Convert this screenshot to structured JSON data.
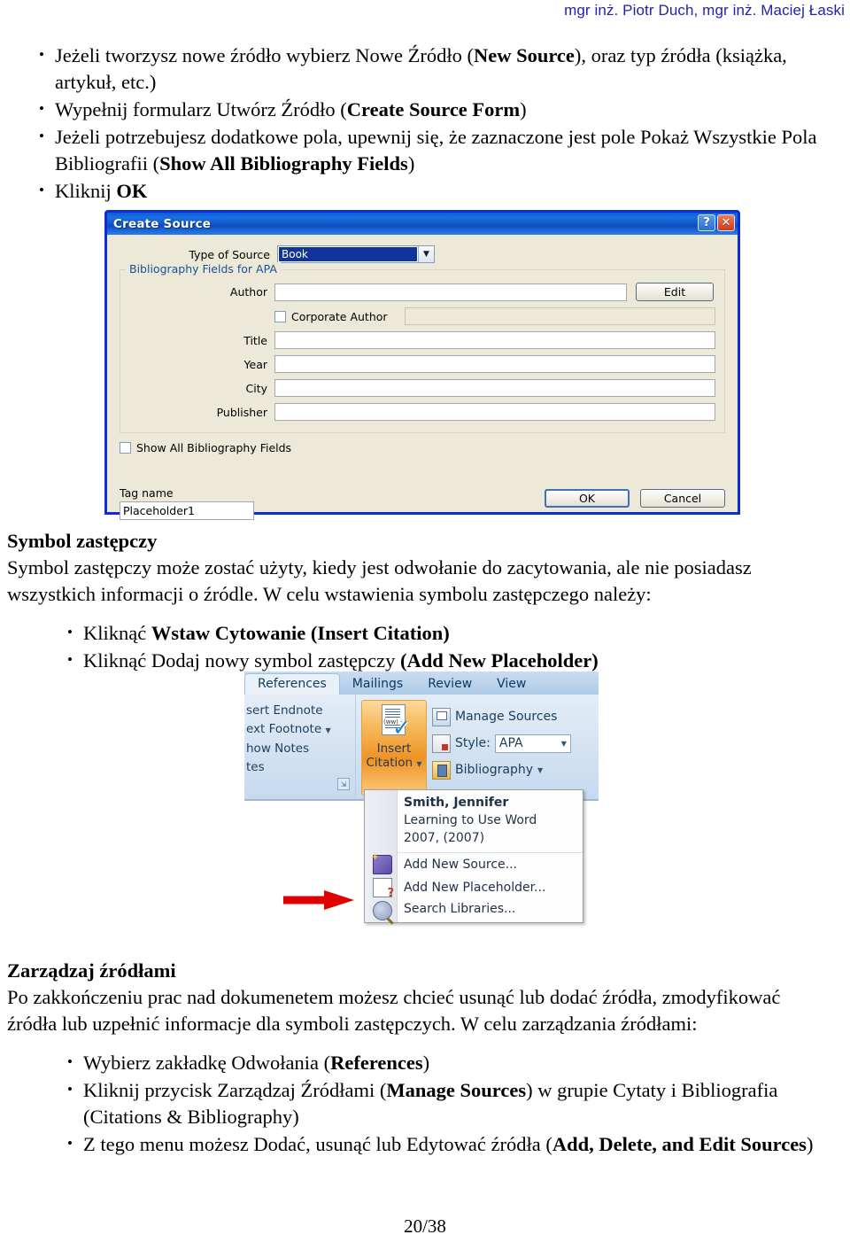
{
  "header": {
    "authors": "mgr inż. Piotr Duch, mgr inż. Maciej Łaski"
  },
  "section_top": {
    "bullets": [
      {
        "prefix": "Jeżeli tworzysz nowe źródło wybierz Nowe Źródło (",
        "bold": "New Source",
        "suffix": "), oraz typ źródła (książka, artykuł, etc.)"
      },
      {
        "prefix": "Wypełnij formularz Utwórz Źródło (",
        "bold": "Create Source Form",
        "suffix": ")"
      },
      {
        "prefix": "Jeżeli potrzebujesz dodatkowe pola, upewnij się, że zaznaczone jest pole Pokaż Wszystkie Pola Bibliografii (",
        "bold": "Show All Bibliography Fields",
        "suffix": ")"
      },
      {
        "prefix": "Kliknij ",
        "bold": "OK",
        "suffix": ""
      }
    ]
  },
  "create_source_dialog": {
    "title": "Create Source",
    "help_button": "?",
    "close_button": "✕",
    "type_of_source_label": "Type of Source",
    "type_of_source_value": "Book",
    "group_title": "Bibliography Fields for APA",
    "fields": [
      {
        "label": "Author",
        "value": ""
      },
      {
        "label": "Title",
        "value": ""
      },
      {
        "label": "Year",
        "value": ""
      },
      {
        "label": "City",
        "value": ""
      },
      {
        "label": "Publisher",
        "value": ""
      }
    ],
    "edit_button": "Edit",
    "corporate_author_label": "Corporate Author",
    "corporate_author_value": "",
    "show_all_label": "Show All Bibliography Fields",
    "tag_name_label": "Tag name",
    "tag_name_value": "Placeholder1",
    "ok_button": "OK",
    "cancel_button": "Cancel"
  },
  "section_middle": {
    "heading": "Symbol zastępczy",
    "paragraph_line1": "Symbol zastępczy może zostać użyty, kiedy jest odwołanie do zacytowania, ale nie posiadasz",
    "paragraph_line2": "wszystkich informacji o źródle.  W celu wstawienia symbolu zastępczego należy:",
    "bullets": [
      {
        "prefix": "Kliknąć ",
        "bold": "Wstaw Cytowanie (Insert Citation)",
        "suffix": ""
      },
      {
        "prefix": "Kliknąć Dodaj nowy symbol zastępczy ",
        "bold": "(Add New Placeholder)",
        "suffix": ""
      }
    ]
  },
  "ribbon": {
    "tabs": [
      {
        "label": "References",
        "active": true
      },
      {
        "label": "Mailings",
        "active": false
      },
      {
        "label": "Review",
        "active": false
      },
      {
        "label": "View",
        "active": false
      }
    ],
    "footnotes_group": [
      "sert Endnote",
      "ext Footnote",
      "how Notes",
      "tes"
    ],
    "insert_citation_label_line1": "Insert",
    "insert_citation_label_line2": "Citation",
    "manage_sources_label": "Manage Sources",
    "style_label": "Style:",
    "style_value": "APA",
    "bibliography_label": "Bibliography",
    "menu": {
      "source_name": "Smith, Jennifer",
      "source_detail": "Learning to Use Word 2007, (2007)",
      "items": [
        {
          "label": "Add New Source...",
          "icon": "book-star-icon"
        },
        {
          "label": "Add New Placeholder...",
          "icon": "placeholder-question-icon"
        },
        {
          "label": "Search Libraries...",
          "icon": "search-library-icon"
        }
      ]
    },
    "arrow_color": "#e00000"
  },
  "section_bottom": {
    "heading": "Zarządzaj źródłami",
    "paragraph_line1": "Po zakkończeniu prac nad dokumenetem możesz chcieć usunąć lub dodać źródła, zmodyfikować",
    "paragraph_line2": "źródła lub uzpełnić informacje dla symboli zastępczych. W celu zarządzania źródłami:",
    "bullets": [
      {
        "prefix": "Wybierz zakładkę Odwołania (",
        "bold": "References",
        "suffix": ")"
      },
      {
        "prefix": "Kliknij przycisk Zarządzaj Źródłami (",
        "bold": "Manage Sources",
        "suffix": ") w grupie Cytaty i Bibliografia (Citations & Bibliography)"
      },
      {
        "prefix": "Z tego menu możesz Dodać, usunąć lub Edytować źródła (",
        "bold": "Add, Delete, and Edit Sources",
        "suffix": ")"
      }
    ]
  },
  "footer": {
    "page_number": "20/38"
  }
}
